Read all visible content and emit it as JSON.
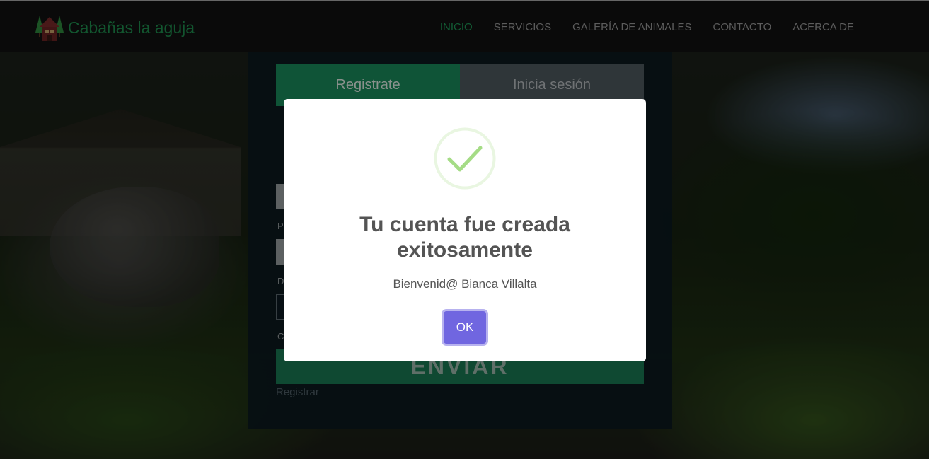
{
  "brand": {
    "name": "Cabañas la aguja",
    "logo_icon": "cabin-trees-icon"
  },
  "nav": {
    "items": [
      {
        "label": "INICIO",
        "active": true
      },
      {
        "label": "SERVICIOS",
        "active": false
      },
      {
        "label": "GALERÍA DE ANIMALES",
        "active": false
      },
      {
        "label": "CONTACTO",
        "active": false
      },
      {
        "label": "ACERCA DE",
        "active": false
      }
    ]
  },
  "form": {
    "tab_register": "Registrate",
    "tab_login": "Inicia sesión",
    "submit_label": "ENVIAR",
    "register_link": "Registrar"
  },
  "modal": {
    "icon": "success-check-icon",
    "title": "Tu cuenta fue creada exitosamente",
    "text": "Bienvenid@ Bianca Villalta",
    "ok_label": "OK"
  },
  "colors": {
    "brand": "#1f8f4f",
    "nav_active": "#1e9a57",
    "tab_active": "#1a8c5c",
    "confirm_button": "#7066e0",
    "success_check": "#a5dc86"
  }
}
